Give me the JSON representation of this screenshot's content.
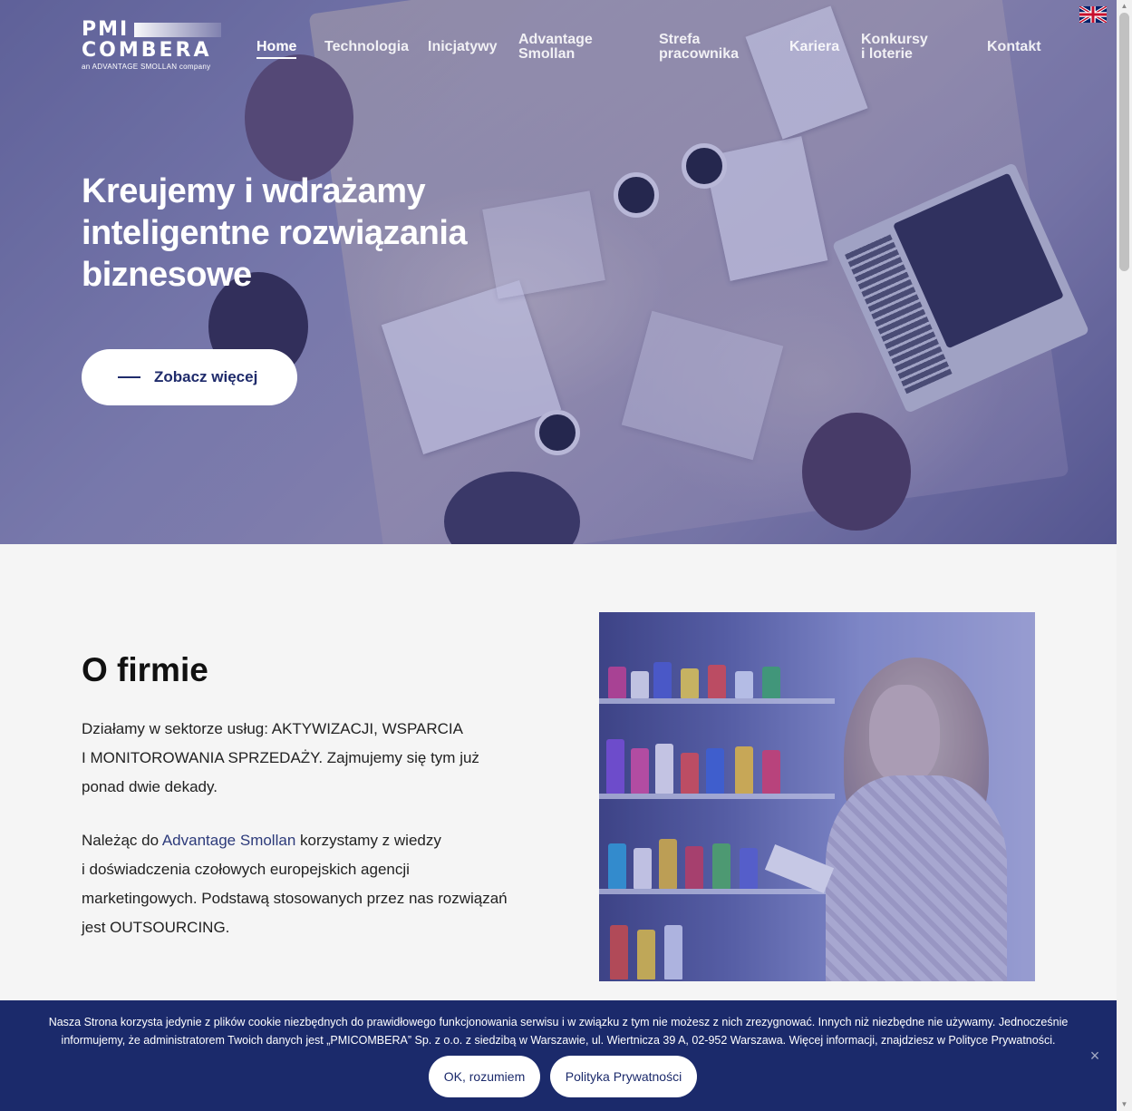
{
  "logo": {
    "line1": "PMI",
    "line2": "COMBERA",
    "tagline": "an ADVANTAGE SMOLLAN company"
  },
  "nav": {
    "home": "Home",
    "technologia": "Technologia",
    "inicjatywy": "Inicjatywy",
    "advantage_1": "Advantage",
    "advantage_2": "Smollan",
    "strefa_1": "Strefa",
    "strefa_2": "pracownika",
    "kariera": "Kariera",
    "konkursy_1": "Konkursy",
    "konkursy_2": "i loterie",
    "kontakt": "Kontakt",
    "language_flag": "uk-flag-icon"
  },
  "hero": {
    "title_line1": "Kreujemy i wdrażamy",
    "title_line2": "inteligentne rozwiązania",
    "title_line3": "biznesowe",
    "button_label": "Zobacz więcej"
  },
  "about": {
    "title": "O firmie",
    "p1_line1": "Działamy w sektorze usług: AKTYWIZACJI, WSPARCIA",
    "p1_line2": "I MONITOROWANIA SPRZEDAŻY. Zajmujemy się tym już",
    "p1_line3": "ponad dwie dekady.",
    "p2_pre": "Należąc do ",
    "p2_link": "Advantage Smollan",
    "p2_post": " korzystamy z wiedzy",
    "p2_line2": "i doświadczenia czołowych europejskich agencji",
    "p2_line3": "marketingowych. Podstawą stosowanych przez nas rozwiązań",
    "p2_line4": "jest OUTSOURCING."
  },
  "cookie": {
    "text_line1": "Nasza Strona korzysta jedynie z plików cookie niezbędnych do prawidłowego funkcjonowania serwisu i w związku z tym nie możesz z nich zrezygnować. Innych niż niezbędne nie używamy. Jednocześnie",
    "text_line2": "informujemy, że administratorem Twoich danych jest „PMICOMBERA” Sp. z o.o. z siedzibą w Warszawie, ul. Wiertnicza 39 A, 02-952 Warszawa. Więcej informacji, znajdziesz w Polityce Prywatności.",
    "ok_label": "OK, rozumiem",
    "policy_label": "Polityka Prywatności",
    "close_symbol": "×"
  },
  "colors": {
    "brand_navy": "#1b2a6b",
    "link": "#2c3a7a"
  }
}
